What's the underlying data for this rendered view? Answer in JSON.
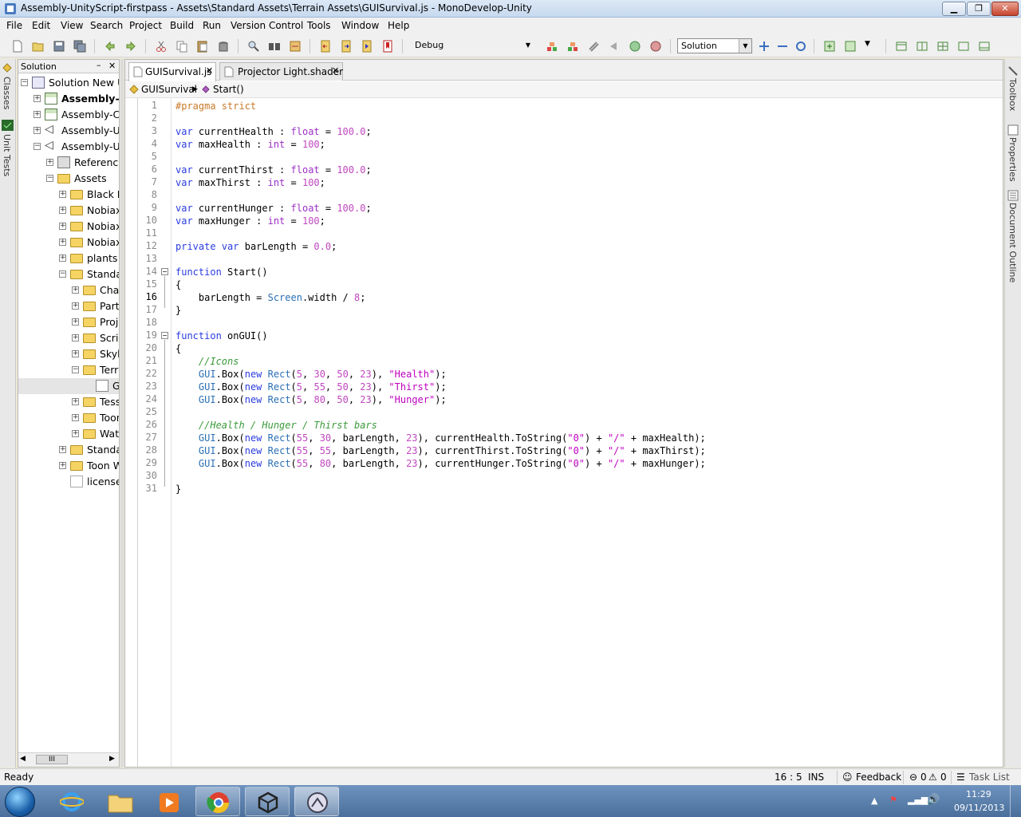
{
  "window": {
    "title": "Assembly-UnityScript-firstpass - Assets\\Standard Assets\\Terrain Assets\\GUISurvival.js - MonoDevelop-Unity",
    "min_glyph": "▁",
    "max_glyph": "❐",
    "close_glyph": "✕"
  },
  "menu": [
    "File",
    "Edit",
    "View",
    "Search",
    "Project",
    "Build",
    "Run",
    "Version Control",
    "Tools",
    "Window",
    "Help"
  ],
  "toolbar": {
    "config": "Debug",
    "search_scope": "Solution"
  },
  "left_strip": {
    "tabs": [
      "Classes",
      "Unit Tests"
    ]
  },
  "right_strip": {
    "tabs": [
      "Toolbox",
      "Properties",
      "Document Outline"
    ]
  },
  "solution_pad": {
    "title": "Solution",
    "min_glyph": "–",
    "close_glyph": "✕",
    "hscroll_glyph": "III",
    "tree": [
      {
        "label": "Solution New Ui",
        "icon": "solution-icon",
        "level": 0,
        "expander": "−"
      },
      {
        "label": "Assembly-C",
        "icon": "project-icon",
        "level": 1,
        "expander": "+",
        "bold": true
      },
      {
        "label": "Assembly-CS",
        "icon": "project-icon",
        "level": 1,
        "expander": "+"
      },
      {
        "label": "Assembly-Un",
        "icon": "unity-project-icon",
        "level": 1,
        "expander": "+"
      },
      {
        "label": "Assembly-Un",
        "icon": "unity-project-icon",
        "level": 1,
        "expander": "−"
      },
      {
        "label": "Reference",
        "icon": "references-icon",
        "level": 2,
        "expander": "+"
      },
      {
        "label": "Assets",
        "icon": "folder-icon",
        "level": 2,
        "expander": "−"
      },
      {
        "label": "Black R",
        "icon": "folder-icon",
        "level": 3,
        "expander": "+"
      },
      {
        "label": "Nobiax",
        "icon": "folder-icon",
        "level": 3,
        "expander": "+"
      },
      {
        "label": "Nobiax",
        "icon": "folder-icon",
        "level": 3,
        "expander": "+"
      },
      {
        "label": "Nobiax",
        "icon": "folder-icon",
        "level": 3,
        "expander": "+"
      },
      {
        "label": "plants",
        "icon": "folder-icon",
        "level": 3,
        "expander": "+"
      },
      {
        "label": "Standa",
        "icon": "folder-icon",
        "level": 3,
        "expander": "−"
      },
      {
        "label": "Char",
        "icon": "folder-icon",
        "level": 4,
        "expander": "+"
      },
      {
        "label": "Parti",
        "icon": "folder-icon",
        "level": 4,
        "expander": "+"
      },
      {
        "label": "Proj",
        "icon": "folder-icon",
        "level": 4,
        "expander": "+"
      },
      {
        "label": "Scrip",
        "icon": "folder-icon",
        "level": 4,
        "expander": "+"
      },
      {
        "label": "Skyb",
        "icon": "folder-icon",
        "level": 4,
        "expander": "+"
      },
      {
        "label": "Terr",
        "icon": "folder-icon",
        "level": 4,
        "expander": "−"
      },
      {
        "label": "G",
        "icon": "js-file-icon",
        "level": 5,
        "expander": "",
        "selected": true
      },
      {
        "label": "Tess",
        "icon": "folder-icon",
        "level": 4,
        "expander": "+"
      },
      {
        "label": "Toon",
        "icon": "folder-icon",
        "level": 4,
        "expander": "+"
      },
      {
        "label": "Wate",
        "icon": "folder-icon",
        "level": 4,
        "expander": "+"
      },
      {
        "label": "Standa",
        "icon": "folder-icon",
        "level": 3,
        "expander": "+"
      },
      {
        "label": "Toon W",
        "icon": "folder-icon",
        "level": 3,
        "expander": "+"
      },
      {
        "label": "license.",
        "icon": "text-file-icon",
        "level": 3,
        "expander": ""
      }
    ]
  },
  "tabs": [
    {
      "label": "GUISurvival.js",
      "active": true,
      "close": "✕"
    },
    {
      "label": "Projector Light.shader",
      "active": false,
      "close": "✕"
    }
  ],
  "pathbar": [
    "GUISurvival",
    "Start()"
  ],
  "editor": {
    "current_line": 16,
    "lines": [
      [
        [
          "pp",
          "#pragma strict"
        ]
      ],
      [],
      [
        [
          "kw",
          "var"
        ],
        [
          "",
          " currentHealth : "
        ],
        [
          "ty",
          "float"
        ],
        [
          "",
          " = "
        ],
        [
          "num",
          "100.0"
        ],
        [
          "",
          ";"
        ]
      ],
      [
        [
          "kw",
          "var"
        ],
        [
          "",
          " maxHealth : "
        ],
        [
          "ty",
          "int"
        ],
        [
          "",
          " = "
        ],
        [
          "num",
          "100"
        ],
        [
          "",
          ";"
        ]
      ],
      [],
      [
        [
          "kw",
          "var"
        ],
        [
          "",
          " currentThirst : "
        ],
        [
          "ty",
          "float"
        ],
        [
          "",
          " = "
        ],
        [
          "num",
          "100.0"
        ],
        [
          "",
          ";"
        ]
      ],
      [
        [
          "kw",
          "var"
        ],
        [
          "",
          " maxThirst : "
        ],
        [
          "ty",
          "int"
        ],
        [
          "",
          " = "
        ],
        [
          "num",
          "100"
        ],
        [
          "",
          ";"
        ]
      ],
      [],
      [
        [
          "kw",
          "var"
        ],
        [
          "",
          " currentHunger : "
        ],
        [
          "ty",
          "float"
        ],
        [
          "",
          " = "
        ],
        [
          "num",
          "100.0"
        ],
        [
          "",
          ";"
        ]
      ],
      [
        [
          "kw",
          "var"
        ],
        [
          "",
          " maxHunger : "
        ],
        [
          "ty",
          "int"
        ],
        [
          "",
          " = "
        ],
        [
          "num",
          "100"
        ],
        [
          "",
          ";"
        ]
      ],
      [],
      [
        [
          "kw",
          "private"
        ],
        [
          "",
          " "
        ],
        [
          "kw",
          "var"
        ],
        [
          "",
          " barLength = "
        ],
        [
          "num",
          "0.0"
        ],
        [
          "",
          ";"
        ]
      ],
      [],
      [
        [
          "kw",
          "function"
        ],
        [
          "",
          " Start()"
        ]
      ],
      [
        [
          "",
          "{"
        ]
      ],
      [
        [
          "",
          "    barLength = "
        ],
        [
          "cls",
          "Screen"
        ],
        [
          "",
          ".width / "
        ],
        [
          "num",
          "8"
        ],
        [
          "",
          ";"
        ]
      ],
      [
        [
          "",
          "}"
        ]
      ],
      [],
      [
        [
          "kw",
          "function"
        ],
        [
          "",
          " onGUI()"
        ]
      ],
      [
        [
          "",
          "{"
        ]
      ],
      [
        [
          "cm",
          "    //Icons"
        ]
      ],
      [
        [
          "",
          "    "
        ],
        [
          "cls",
          "GUI"
        ],
        [
          "",
          ".Box("
        ],
        [
          "kw",
          "new"
        ],
        [
          "",
          " "
        ],
        [
          "cls",
          "Rect"
        ],
        [
          "",
          "("
        ],
        [
          "num",
          "5"
        ],
        [
          "",
          ", "
        ],
        [
          "num",
          "30"
        ],
        [
          "",
          ", "
        ],
        [
          "num",
          "50"
        ],
        [
          "",
          ", "
        ],
        [
          "num",
          "23"
        ],
        [
          "",
          "), "
        ],
        [
          "str",
          "\"Health\""
        ],
        [
          "",
          ");"
        ]
      ],
      [
        [
          "",
          "    "
        ],
        [
          "cls",
          "GUI"
        ],
        [
          "",
          ".Box("
        ],
        [
          "kw",
          "new"
        ],
        [
          "",
          " "
        ],
        [
          "cls",
          "Rect"
        ],
        [
          "",
          "("
        ],
        [
          "num",
          "5"
        ],
        [
          "",
          ", "
        ],
        [
          "num",
          "55"
        ],
        [
          "",
          ", "
        ],
        [
          "num",
          "50"
        ],
        [
          "",
          ", "
        ],
        [
          "num",
          "23"
        ],
        [
          "",
          "), "
        ],
        [
          "str",
          "\"Thirst\""
        ],
        [
          "",
          ");"
        ]
      ],
      [
        [
          "",
          "    "
        ],
        [
          "cls",
          "GUI"
        ],
        [
          "",
          ".Box("
        ],
        [
          "kw",
          "new"
        ],
        [
          "",
          " "
        ],
        [
          "cls",
          "Rect"
        ],
        [
          "",
          "("
        ],
        [
          "num",
          "5"
        ],
        [
          "",
          ", "
        ],
        [
          "num",
          "80"
        ],
        [
          "",
          ", "
        ],
        [
          "num",
          "50"
        ],
        [
          "",
          ", "
        ],
        [
          "num",
          "23"
        ],
        [
          "",
          "), "
        ],
        [
          "str",
          "\"Hunger\""
        ],
        [
          "",
          ");"
        ]
      ],
      [],
      [
        [
          "cm",
          "    //Health / Hunger / Thirst bars"
        ]
      ],
      [
        [
          "",
          "    "
        ],
        [
          "cls",
          "GUI"
        ],
        [
          "",
          ".Box("
        ],
        [
          "kw",
          "new"
        ],
        [
          "",
          " "
        ],
        [
          "cls",
          "Rect"
        ],
        [
          "",
          "("
        ],
        [
          "num",
          "55"
        ],
        [
          "",
          ", "
        ],
        [
          "num",
          "30"
        ],
        [
          "",
          ", barLength, "
        ],
        [
          "num",
          "23"
        ],
        [
          "",
          "), currentHealth.ToString("
        ],
        [
          "str",
          "\"0\""
        ],
        [
          "",
          ") + "
        ],
        [
          "str",
          "\"/\""
        ],
        [
          "",
          " + maxHealth);"
        ]
      ],
      [
        [
          "",
          "    "
        ],
        [
          "cls",
          "GUI"
        ],
        [
          "",
          ".Box("
        ],
        [
          "kw",
          "new"
        ],
        [
          "",
          " "
        ],
        [
          "cls",
          "Rect"
        ],
        [
          "",
          "("
        ],
        [
          "num",
          "55"
        ],
        [
          "",
          ", "
        ],
        [
          "num",
          "55"
        ],
        [
          "",
          ", barLength, "
        ],
        [
          "num",
          "23"
        ],
        [
          "",
          "), currentThirst.ToString("
        ],
        [
          "str",
          "\"0\""
        ],
        [
          "",
          ") + "
        ],
        [
          "str",
          "\"/\""
        ],
        [
          "",
          " + maxThirst);"
        ]
      ],
      [
        [
          "",
          "    "
        ],
        [
          "cls",
          "GUI"
        ],
        [
          "",
          ".Box("
        ],
        [
          "kw",
          "new"
        ],
        [
          "",
          " "
        ],
        [
          "cls",
          "Rect"
        ],
        [
          "",
          "("
        ],
        [
          "num",
          "55"
        ],
        [
          "",
          ", "
        ],
        [
          "num",
          "80"
        ],
        [
          "",
          ", barLength, "
        ],
        [
          "num",
          "23"
        ],
        [
          "",
          "), currentHunger.ToString("
        ],
        [
          "str",
          "\"0\""
        ],
        [
          "",
          ") + "
        ],
        [
          "str",
          "\"/\""
        ],
        [
          "",
          " + maxHunger);"
        ]
      ],
      [],
      [
        [
          "",
          "}"
        ]
      ]
    ]
  },
  "statusbar": {
    "status": "Ready",
    "position": "16 : 5",
    "mode": "INS",
    "feedback": "Feedback",
    "errors": "0",
    "warnings": "0",
    "task_list": "Task List"
  },
  "taskbar": {
    "time": "11:29",
    "date": "09/11/2013"
  }
}
